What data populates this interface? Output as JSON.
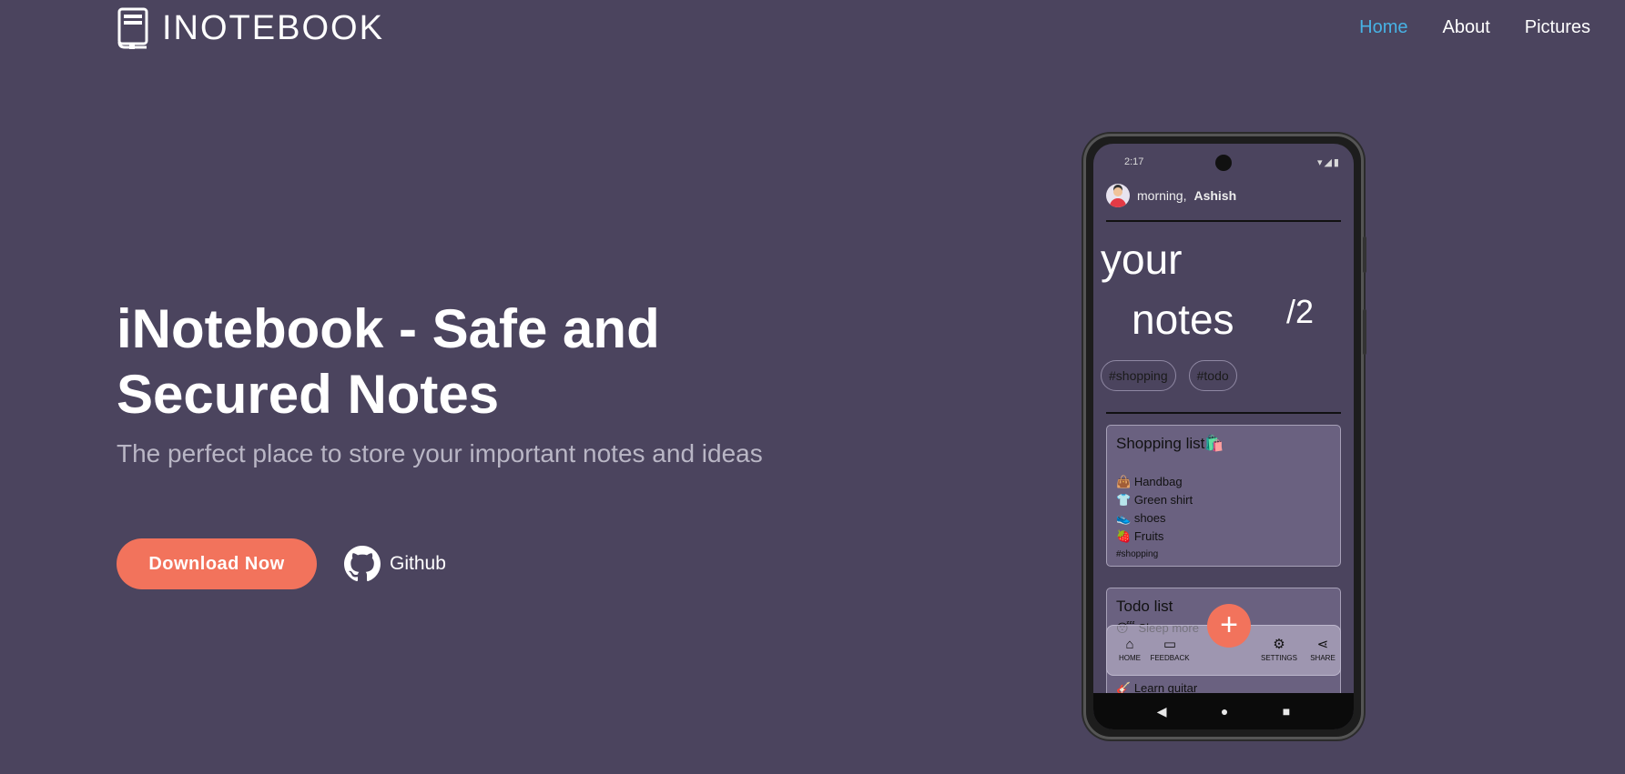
{
  "header": {
    "logo_text": "INOTEBOOK",
    "nav": [
      {
        "label": "Home",
        "active": true
      },
      {
        "label": "About",
        "active": false
      },
      {
        "label": "Pictures",
        "active": false
      }
    ]
  },
  "hero": {
    "title": "iNotebook - Safe and Secured Notes",
    "subtitle": "The perfect place to store your important notes and ideas",
    "download_label": "Download Now",
    "github_label": "Github"
  },
  "phone": {
    "status_time": "2:17",
    "greeting_prefix": "morning,",
    "greeting_name": "Ashish",
    "title_line1": "your",
    "title_line2": "notes",
    "note_count": "/2",
    "tags": [
      "#shopping",
      "#todo"
    ],
    "notes": [
      {
        "title": "Shopping list",
        "title_emoji": "🛍️",
        "items": [
          {
            "emoji": "👜",
            "text": "Handbag"
          },
          {
            "emoji": "👕",
            "text": "Green shirt"
          },
          {
            "emoji": "👟",
            "text": "shoes"
          },
          {
            "emoji": "🍓",
            "text": "Fruits"
          }
        ],
        "hashtag": "#shopping"
      },
      {
        "title": "Todo list",
        "items": [
          {
            "emoji": "😴",
            "text": "Sleep more"
          },
          {
            "emoji": "🎸",
            "text": "Learn guitar"
          }
        ]
      }
    ],
    "bottom_nav": [
      {
        "icon": "home-icon",
        "label": "HOME"
      },
      {
        "icon": "feedback-icon",
        "label": "FEEDBACK"
      },
      {
        "icon": "settings-icon",
        "label": "SETTINGS"
      },
      {
        "icon": "share-icon",
        "label": "SHARE"
      }
    ],
    "fab_symbol": "+",
    "android_nav": [
      "◀",
      "●",
      "■"
    ]
  },
  "colors": {
    "background": "#4b445e",
    "accent": "#f2735c",
    "nav_active": "#47b2e4"
  }
}
